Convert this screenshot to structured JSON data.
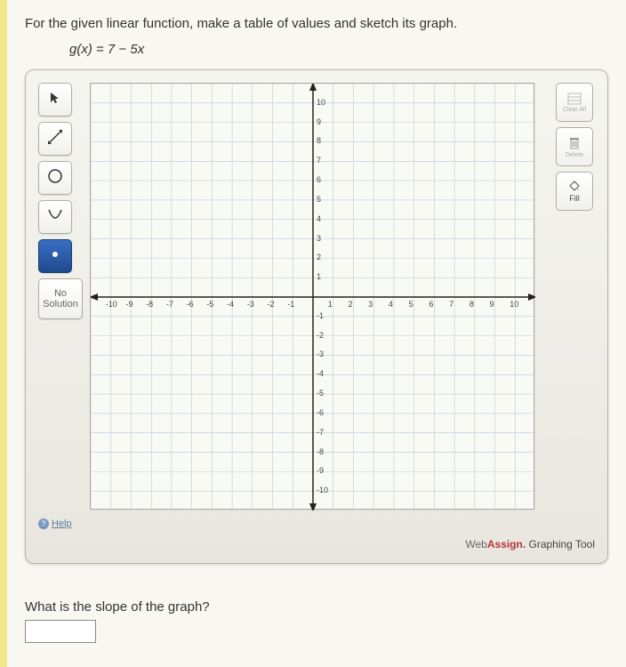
{
  "question": {
    "prompt": "For the given linear function, make a table of values and sketch its graph.",
    "formula": "g(x) = 7 − 5x",
    "slope_question": "What is the slope of the graph?"
  },
  "tools": {
    "left": {
      "pointer": "▸",
      "line": "↗",
      "circle": "○",
      "parabola": "∪",
      "point": "•",
      "no_solution": "No Solution"
    },
    "right": {
      "clear": "Clear All",
      "delete": "Delete",
      "fill": "Fill"
    },
    "selected": "point"
  },
  "help": {
    "label": "Help"
  },
  "branding": {
    "web": "Web",
    "assign": "Assign.",
    "suffix": " Graphing Tool"
  },
  "chart_data": {
    "type": "scatter",
    "title": "",
    "xlabel": "",
    "ylabel": "",
    "xlim": [
      -11,
      11
    ],
    "ylim": [
      -11,
      11
    ],
    "grid": true,
    "x_ticks": [
      -10,
      -9,
      -8,
      -7,
      -6,
      -5,
      -4,
      -3,
      -2,
      -1,
      1,
      2,
      3,
      4,
      5,
      6,
      7,
      8,
      9,
      10
    ],
    "y_ticks": [
      -10,
      -9,
      -8,
      -7,
      -6,
      -5,
      -4,
      -3,
      -2,
      -1,
      1,
      2,
      3,
      4,
      5,
      6,
      7,
      8,
      9,
      10
    ],
    "series": []
  }
}
